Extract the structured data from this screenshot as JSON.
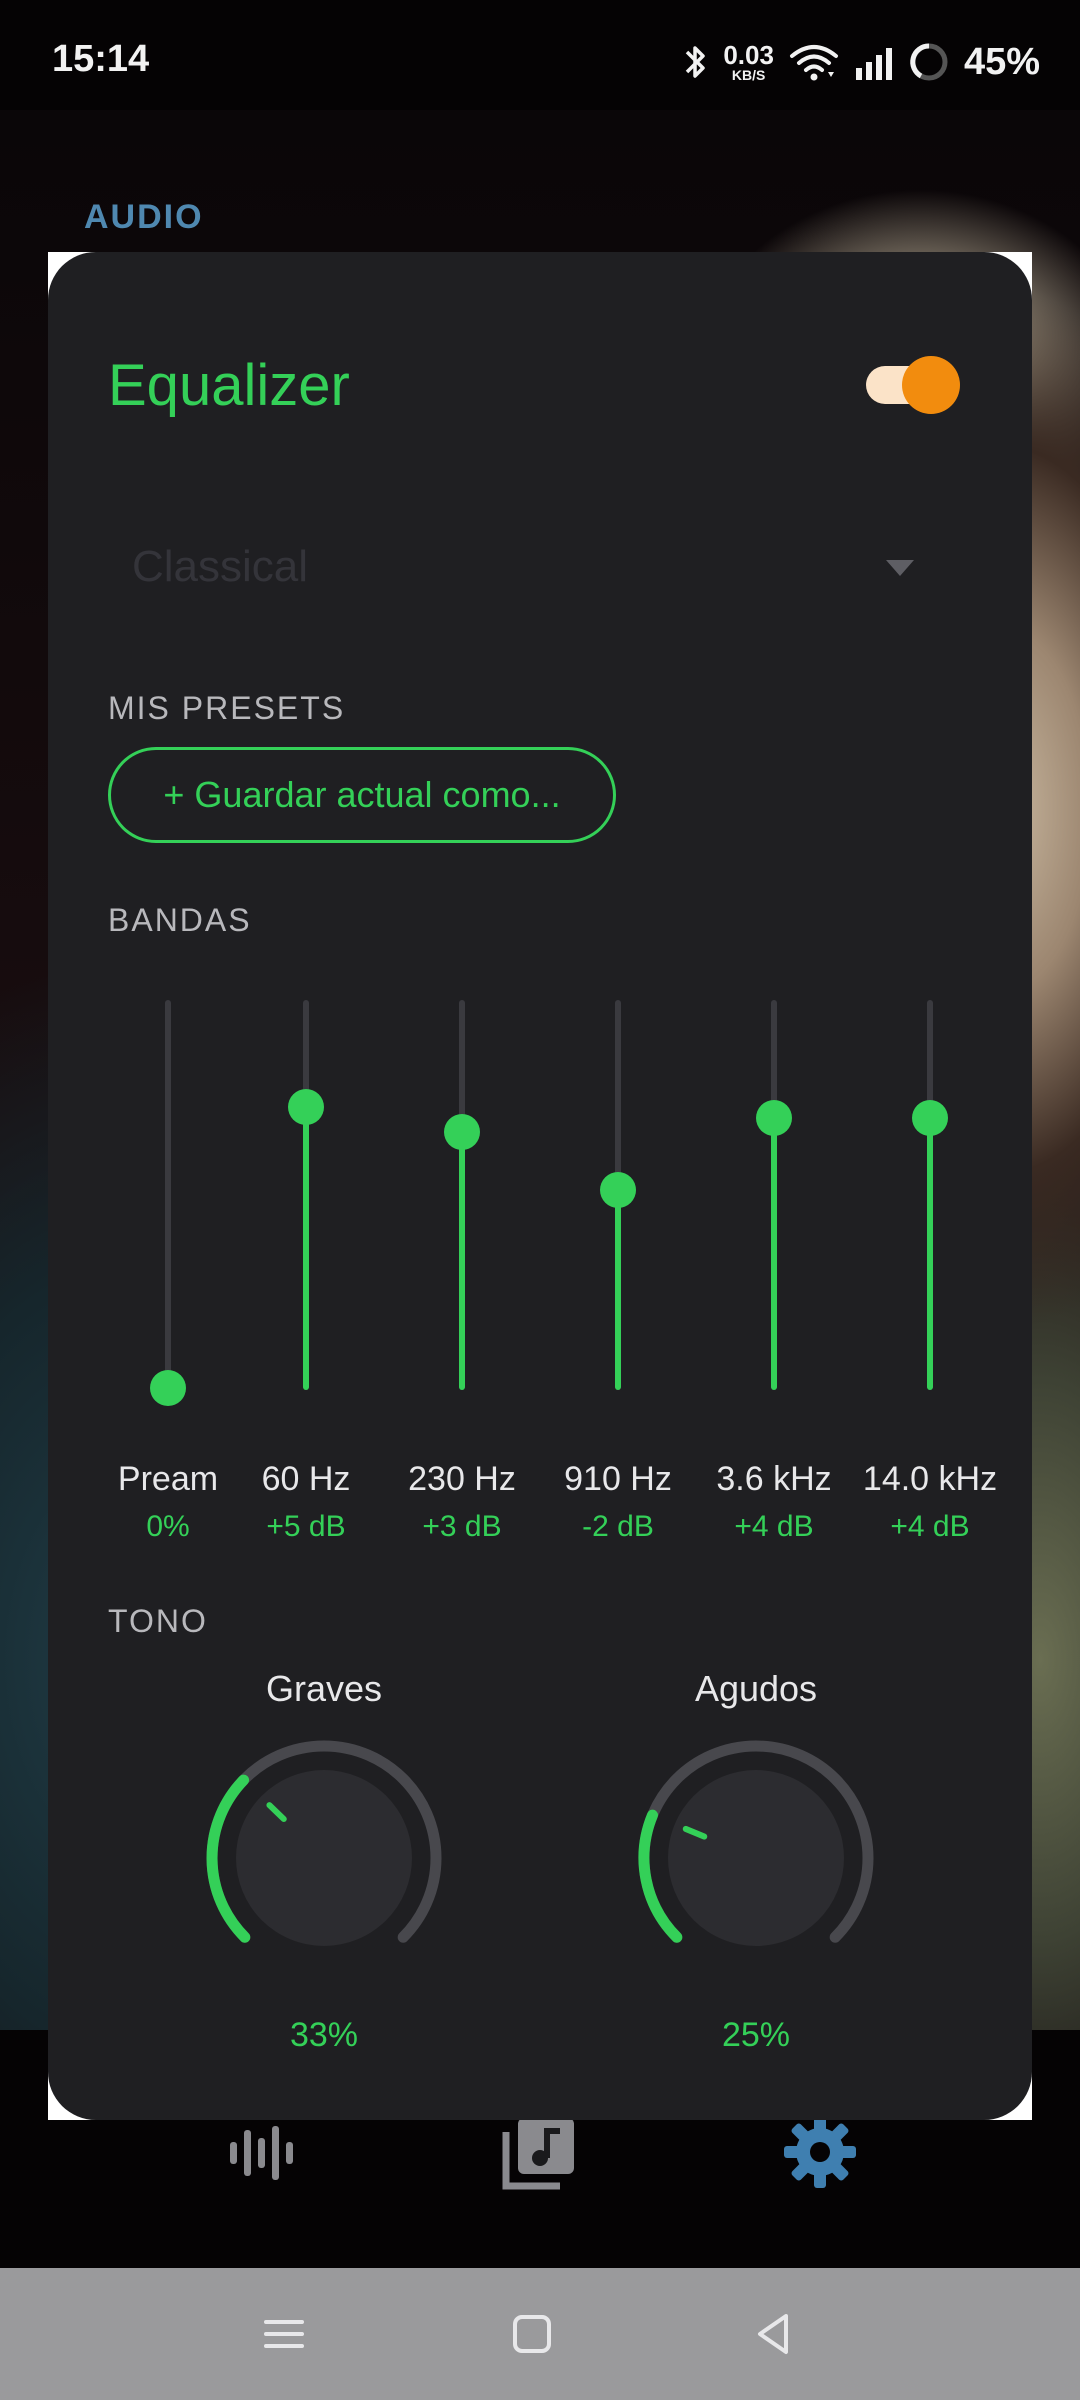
{
  "status_bar": {
    "time": "15:14",
    "net_speed_value": "0.03",
    "net_speed_unit": "KB/S",
    "battery": "45%",
    "icons": [
      "bluetooth-icon",
      "wifi-icon",
      "signal-icon",
      "battery-ring-icon"
    ]
  },
  "section_header": "AUDIO",
  "equalizer": {
    "title": "Equalizer",
    "enabled": true,
    "preset": "Classical",
    "my_presets_label": "MIS PRESETS",
    "save_preset_label": "+ Guardar actual como...",
    "bands_label": "BANDAS",
    "bands": [
      {
        "name": "Pream",
        "value": "0%",
        "level": 0.0
      },
      {
        "name": "60 Hz",
        "value": "+5 dB",
        "level": 0.78
      },
      {
        "name": "230 Hz",
        "value": "+3 dB",
        "level": 0.71
      },
      {
        "name": "910 Hz",
        "value": "-2 dB",
        "level": 0.55
      },
      {
        "name": "3.6 kHz",
        "value": "+4 dB",
        "level": 0.75
      },
      {
        "name": "14.0 kHz",
        "value": "+4 dB",
        "level": 0.75
      }
    ],
    "tone_label": "TONO",
    "tone": [
      {
        "name": "Graves",
        "value": "33%",
        "level": 0.33
      },
      {
        "name": "Agudos",
        "value": "25%",
        "level": 0.25
      }
    ]
  },
  "bottom_nav": [
    "waveform-icon",
    "music-library-icon",
    "settings-gear-icon"
  ],
  "system_nav": [
    "menu-icon",
    "home-icon",
    "back-icon"
  ],
  "colors": {
    "accent": "#34d058",
    "toggle_thumb": "#f28c0e",
    "toggle_track": "#fbe3c8",
    "header_blue": "#4f88b0",
    "card_bg": "#1f1f22"
  }
}
